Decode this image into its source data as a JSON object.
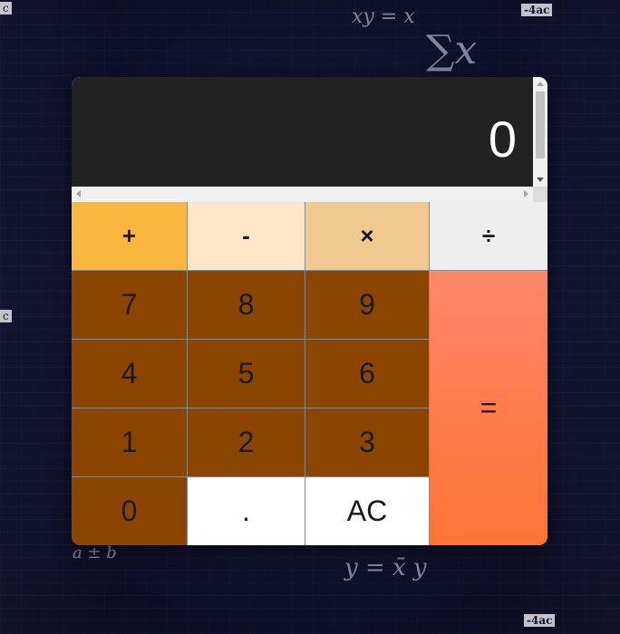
{
  "calculator": {
    "display": "0",
    "keys": {
      "plus": "+",
      "minus": "-",
      "times": "×",
      "divide": "÷",
      "seven": "7",
      "eight": "8",
      "nine": "9",
      "four": "4",
      "five": "5",
      "six": "6",
      "one": "1",
      "two": "2",
      "three": "3",
      "zero": "0",
      "dot": ".",
      "clear": "AC",
      "equals": "="
    }
  },
  "background": {
    "formulas": [
      "xy = x",
      "-4ac",
      "∑x",
      "y = x̄ y",
      "a ± b",
      "-4ac",
      "c",
      "c"
    ]
  },
  "colors": {
    "display_bg": "#222222",
    "plus_key": "#f9b73e",
    "minus_key": "#ffe6c8",
    "times_key": "#efc990",
    "divide_key": "#eeeeee",
    "number_key": "#8b4500",
    "equals_key": "#ff7a48",
    "light_key": "#ffffff"
  }
}
